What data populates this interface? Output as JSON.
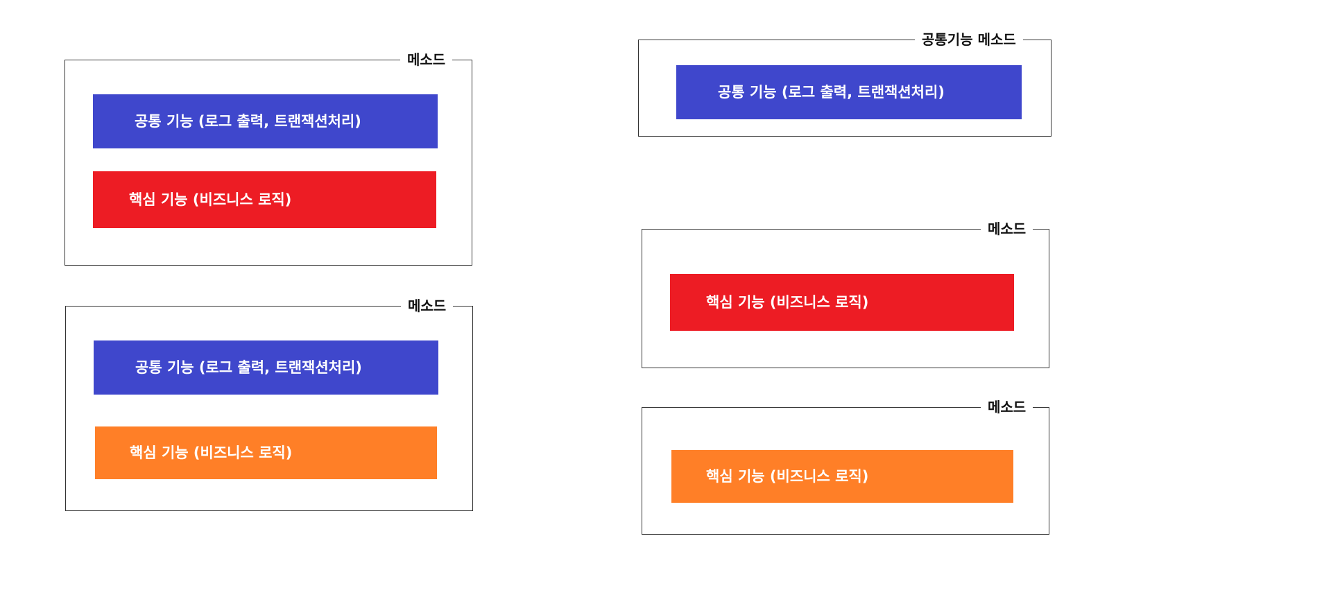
{
  "colors": {
    "common": "#3f47cc",
    "core_red": "#ed1c24",
    "core_orange": "#ff7f27",
    "border": "#333333",
    "text": "#ffffff"
  },
  "frames": [
    {
      "title": "메소드",
      "blocks": [
        {
          "label": "공통 기능  (로그 출력, 트랜잭션처리)",
          "color": "common"
        },
        {
          "label": "핵심 기능 (비즈니스 로직)",
          "color": "core_red"
        }
      ]
    },
    {
      "title": "메소드",
      "blocks": [
        {
          "label": "공통 기능  (로그 출력, 트랜잭션처리)",
          "color": "common"
        },
        {
          "label": "핵심 기능 (비즈니스 로직)",
          "color": "core_orange"
        }
      ]
    },
    {
      "title": "공통기능 메소드",
      "blocks": [
        {
          "label": "공통 기능  (로그 출력, 트랜잭션처리)",
          "color": "common"
        }
      ]
    },
    {
      "title": "메소드",
      "blocks": [
        {
          "label": "핵심 기능 (비즈니스 로직)",
          "color": "core_red"
        }
      ]
    },
    {
      "title": "메소드",
      "blocks": [
        {
          "label": "핵심 기능 (비즈니스 로직)",
          "color": "core_orange"
        }
      ]
    }
  ]
}
